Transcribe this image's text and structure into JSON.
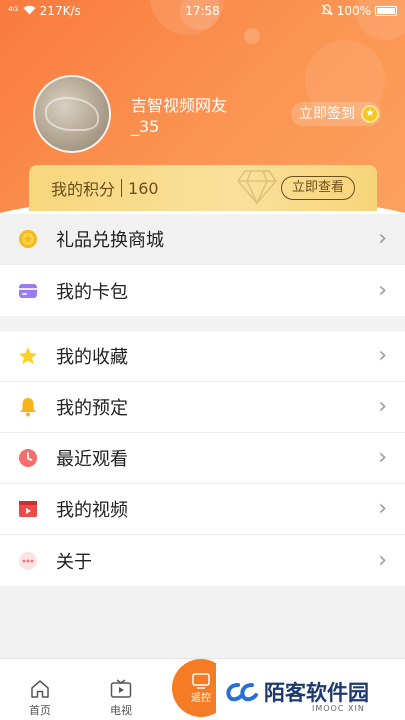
{
  "statusbar": {
    "signal": "⁴ᴳ",
    "speed": "217K/s",
    "time": "17:58",
    "battery": "100%"
  },
  "profile": {
    "username": "吉智视频网友_35",
    "signin_label": "立即签到"
  },
  "points": {
    "label": "我的积分",
    "value": "160",
    "view_label": "立即查看"
  },
  "menu_group_1": [
    {
      "label": "礼品兑换商城",
      "icon": "gift-coin-icon"
    },
    {
      "label": "我的卡包",
      "icon": "card-wallet-icon"
    }
  ],
  "menu_group_2": [
    {
      "label": "我的收藏",
      "icon": "star-icon"
    },
    {
      "label": "我的预定",
      "icon": "bell-icon"
    },
    {
      "label": "最近观看",
      "icon": "clock-icon"
    },
    {
      "label": "我的视频",
      "icon": "video-icon"
    },
    {
      "label": "关于",
      "icon": "more-dots-icon"
    }
  ],
  "tabbar": {
    "home_label": "首页",
    "tv_label": "电视",
    "center_label": "遥控"
  },
  "watermark": {
    "text": "陌客软件园",
    "sub": "IMOOC XIN"
  },
  "colors": {
    "accent": "#f97a3e",
    "gold": "#f7d77e"
  }
}
